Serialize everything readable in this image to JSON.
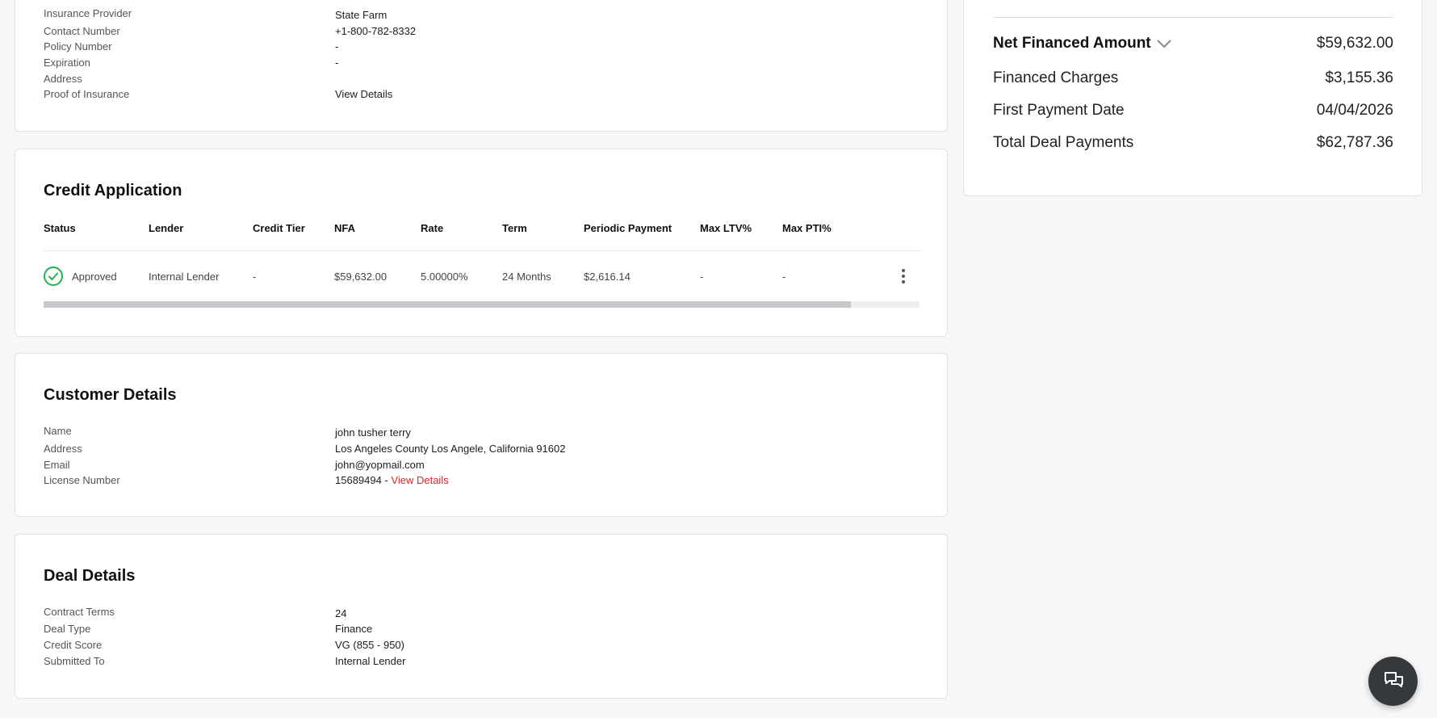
{
  "insurance": {
    "rows": [
      {
        "label": "Insurance Provider",
        "value": "State Farm"
      },
      {
        "label": "Contact Number",
        "value": "+1-800-782-8332"
      },
      {
        "label": "Policy Number",
        "value": "-"
      },
      {
        "label": "Expiration",
        "value": "-"
      },
      {
        "label": "Address",
        "value": ""
      },
      {
        "label": "Proof of Insurance",
        "value": "View Details"
      }
    ]
  },
  "credit_application": {
    "title": "Credit Application",
    "columns": [
      "Status",
      "Lender",
      "Credit Tier",
      "NFA",
      "Rate",
      "Term",
      "Periodic Payment",
      "Max LTV%",
      "Max PTI%"
    ],
    "row": {
      "status": "Approved",
      "lender": "Internal Lender",
      "credit_tier": "-",
      "nfa": "$59,632.00",
      "rate": "5.00000%",
      "term": "24 Months",
      "periodic_payment": "$2,616.14",
      "max_ltv": "-",
      "max_pti": "-"
    },
    "status_color": "#22b14c",
    "scroll_fraction": 0.922
  },
  "customer": {
    "title": "Customer Details",
    "rows": [
      {
        "label": "Name",
        "value": "john tusher terry"
      },
      {
        "label": "Address",
        "value": "Los Angeles County Los Angele, California 91602"
      },
      {
        "label": "Email",
        "value": "john@yopmail.com"
      },
      {
        "label": "License Number",
        "value": "15689494 - ",
        "link": "View Details"
      }
    ]
  },
  "deal": {
    "title": "Deal Details",
    "rows": [
      {
        "label": "Contract Terms",
        "value": "24"
      },
      {
        "label": "Deal Type",
        "value": "Finance"
      },
      {
        "label": "Credit Score",
        "value": "VG (855 - 950)"
      },
      {
        "label": "Submitted To",
        "value": "Internal Lender"
      }
    ]
  },
  "summary": {
    "net_financed": {
      "label": "Net Financed Amount",
      "value": "$59,632.00",
      "icon": "chevron-down-icon"
    },
    "financed_charges": {
      "label": "Financed Charges",
      "value": "$3,155.36"
    },
    "first_payment_date": {
      "label": "First Payment Date",
      "value": "04/04/2026"
    },
    "total_deal_payments": {
      "label": "Total Deal Payments",
      "value": "$62,787.36"
    }
  },
  "chat": {
    "icon": "chat-icon"
  },
  "colors": {
    "accent_link": "#d12b2b",
    "fab": "#35383d"
  }
}
